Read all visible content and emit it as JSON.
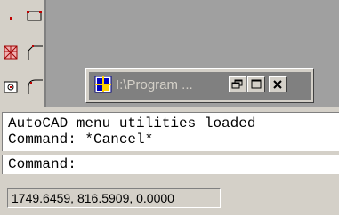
{
  "toolbar": {
    "icons": [
      "point-icon",
      "rectangle-icon",
      "hatch-icon",
      "polyline-icon",
      "region-icon",
      "fillet-icon"
    ]
  },
  "minimized_window": {
    "title": "I:\\Program ...",
    "icon": "application-icon",
    "buttons": [
      "restore-icon",
      "maximize-icon",
      "close-icon"
    ]
  },
  "command_window": {
    "history": [
      "AutoCAD menu utilities loaded",
      "Command: *Cancel*"
    ],
    "prompt": "Command:"
  },
  "status_bar": {
    "coordinates": "1749.6459, 816.5909, 0.0000"
  }
}
